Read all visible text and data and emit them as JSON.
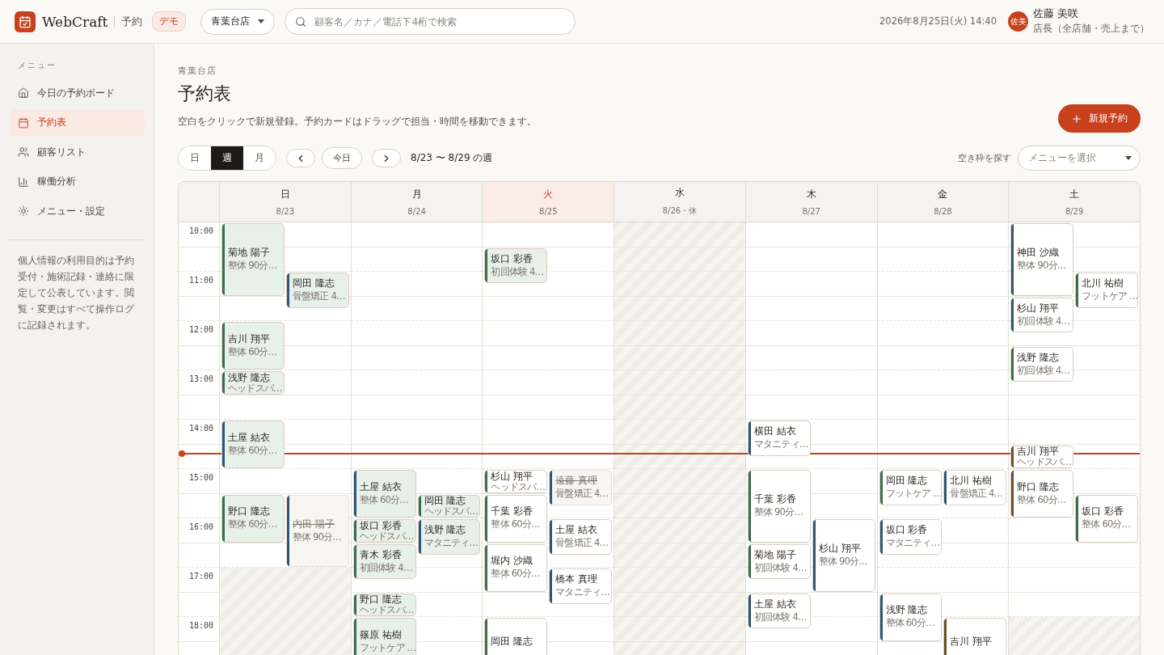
{
  "app": {
    "brand": "WebCraft",
    "module": "予約",
    "badge": "デモ"
  },
  "store_select": {
    "value": "青葉台店"
  },
  "search": {
    "placeholder": "顧客名／カナ／電話下4桁で検索"
  },
  "datetime": "2026年8月25日(火) 14:40",
  "user": {
    "avatar": "佐美",
    "name": "佐藤 美咲",
    "role": "店長（全店舗・売上まで）"
  },
  "sidebar": {
    "heading": "メニュー",
    "items": [
      {
        "label": "今日の予約ボード",
        "selected": false
      },
      {
        "label": "予約表",
        "selected": true
      },
      {
        "label": "顧客リスト",
        "selected": false
      },
      {
        "label": "稼働分析",
        "selected": false
      },
      {
        "label": "メニュー・設定",
        "selected": false
      }
    ],
    "note": "個人情報の利用目的は予約受付・施術記録・連絡に限定して公表しています。閲覧・変更はすべて操作ログに記録されます。"
  },
  "page": {
    "breadcrumb": "青葉台店",
    "title": "予約表",
    "description": "空白をクリックで新規登録。予約カードはドラッグで担当・時間を移動できます。",
    "new_button": "新規予約"
  },
  "view_tabs": [
    {
      "label": "日",
      "selected": false
    },
    {
      "label": "週",
      "selected": true
    },
    {
      "label": "月",
      "selected": false
    }
  ],
  "today_button": "今日",
  "range": "8/23 〜 8/29 の週",
  "slot_finder": {
    "label": "空き枠を探す",
    "placeholder": "メニューを選択"
  },
  "calendar": {
    "times": [
      "10:00",
      "11:00",
      "12:00",
      "13:00",
      "14:00",
      "15:00",
      "16:00",
      "17:00",
      "18:00"
    ],
    "days": [
      {
        "name": "日",
        "date": "8/23",
        "today": false,
        "closed": false,
        "bookings": [
          {
            "name": "菊地 陽子",
            "menu": "整体 90分…",
            "kind": "done",
            "color": "#3f6b4e"
          },
          {
            "name": "岡田 隆志",
            "menu": "骨盤矯正 4…",
            "kind": "done",
            "color": "#2f5679"
          },
          {
            "name": "吉川 翔平",
            "menu": "整体 60分…",
            "kind": "done",
            "color": "#3f6b4e"
          },
          {
            "name": "浅野 隆志",
            "menu": "ヘッドスパ…",
            "kind": "done",
            "color": "#3f6b4e"
          },
          {
            "name": "土屋 結衣",
            "menu": "整体 60分…",
            "kind": "done",
            "color": "#2f5679"
          },
          {
            "name": "野口 隆志",
            "menu": "整体 60分…",
            "kind": "done",
            "color": "#3f6b4e"
          },
          {
            "name": "内田 陽子",
            "menu": "整体 90分…",
            "kind": "cancelled",
            "color": "#2f5679"
          }
        ]
      },
      {
        "name": "月",
        "date": "8/24",
        "today": false,
        "closed": false,
        "bookings": [
          {
            "name": "土屋 結衣",
            "menu": "整体 60分…",
            "kind": "done",
            "color": "#2f5679"
          },
          {
            "name": "岡田 隆志",
            "menu": "ヘッドスパ…",
            "kind": "done",
            "color": "#3f6b4e"
          },
          {
            "name": "坂口 彩香",
            "menu": "ヘッドスパ…",
            "kind": "done",
            "color": "#3f6b4e"
          },
          {
            "name": "浅野 隆志",
            "menu": "マタニティ…",
            "kind": "done",
            "color": "#2f5679"
          },
          {
            "name": "青木 彩香",
            "menu": "初回体験 4…",
            "kind": "done",
            "color": "#3f6b4e"
          },
          {
            "name": "野口 隆志",
            "menu": "ヘッドスパ…",
            "kind": "done",
            "color": "#3f6b4e"
          },
          {
            "name": "篠原 祐樹",
            "menu": "フットケア …",
            "kind": "done",
            "color": "#3f6b4e"
          }
        ]
      },
      {
        "name": "火",
        "date": "8/25",
        "today": true,
        "closed": false,
        "bookings": [
          {
            "name": "坂口 彩香",
            "menu": "初回体験 4…",
            "kind": "done",
            "color": "#3f6b4e"
          },
          {
            "name": "杉山 翔平",
            "menu": "ヘッドスパ…",
            "kind": "booked",
            "color": "#3f6b4e"
          },
          {
            "name": "遠藤 真理",
            "menu": "骨盤矯正 4…",
            "kind": "cancelled",
            "color": "#2f5679"
          },
          {
            "name": "千葉 彩香",
            "menu": "整体 60分…",
            "kind": "booked",
            "color": "#3f6b4e"
          },
          {
            "name": "土屋 結衣",
            "menu": "骨盤矯正 4…",
            "kind": "booked",
            "color": "#2f5679"
          },
          {
            "name": "堀内 沙織",
            "menu": "整体 60分…",
            "kind": "booked",
            "color": "#3f6b4e"
          },
          {
            "name": "橋本 真理",
            "menu": "マタニティ…",
            "kind": "booked",
            "color": "#2f5679"
          },
          {
            "name": "岡田 隆志",
            "kind": "booked",
            "color": "#3f6b4e"
          }
        ]
      },
      {
        "name": "水",
        "date": "8/26・休",
        "today": false,
        "closed": true
      },
      {
        "name": "木",
        "date": "8/27",
        "today": false,
        "closed": false,
        "bookings": [
          {
            "name": "横田 結衣",
            "menu": "マタニティ…",
            "kind": "booked",
            "color": "#2f5679"
          },
          {
            "name": "千葉 彩香",
            "menu": "整体 90分…",
            "kind": "booked",
            "color": "#3f6b4e"
          },
          {
            "name": "杉山 翔平",
            "menu": "整体 90分…",
            "kind": "booked",
            "color": "#2f5679"
          },
          {
            "name": "菊地 陽子",
            "menu": "初回体験 4…",
            "kind": "booked",
            "color": "#3f6b4e"
          },
          {
            "name": "土屋 結衣",
            "menu": "初回体験 4…",
            "kind": "booked",
            "color": "#2f5679"
          }
        ]
      },
      {
        "name": "金",
        "date": "8/28",
        "today": false,
        "closed": false,
        "bookings": [
          {
            "name": "岡田 隆志",
            "menu": "フットケア …",
            "kind": "booked",
            "color": "#3f6b4e"
          },
          {
            "name": "北川 祐樹",
            "menu": "骨盤矯正 4…",
            "kind": "booked",
            "color": "#2f5679"
          },
          {
            "name": "坂口 彩香",
            "menu": "マタニティ…",
            "kind": "booked",
            "color": "#2f5679"
          },
          {
            "name": "浅野 隆志",
            "menu": "整体 60分…",
            "kind": "booked",
            "color": "#2f5679"
          },
          {
            "name": "吉川 翔平",
            "kind": "booked",
            "color": "#6b4f2c"
          }
        ]
      },
      {
        "name": "土",
        "date": "8/29",
        "today": false,
        "closed": false,
        "bookings": [
          {
            "name": "神田 沙織",
            "menu": "整体 90分…",
            "kind": "booked",
            "color": "#2f5679"
          },
          {
            "name": "北川 祐樹",
            "menu": "フットケア …",
            "kind": "booked",
            "color": "#3f6b4e"
          },
          {
            "name": "杉山 翔平",
            "menu": "初回体験 4…",
            "kind": "booked",
            "color": "#2f5679"
          },
          {
            "name": "浅野 隆志",
            "menu": "初回体験 4…",
            "kind": "booked",
            "color": "#3f6b4e"
          },
          {
            "name": "吉川 翔平",
            "menu": "ヘッドスパ…",
            "kind": "booked",
            "color": "#6b4f2c"
          },
          {
            "name": "野口 隆志",
            "menu": "整体 60分…",
            "kind": "booked",
            "color": "#6b4f2c"
          },
          {
            "name": "坂口 彩香",
            "menu": "整体 60分…",
            "kind": "booked",
            "color": "#3f6b4e"
          }
        ]
      }
    ]
  }
}
